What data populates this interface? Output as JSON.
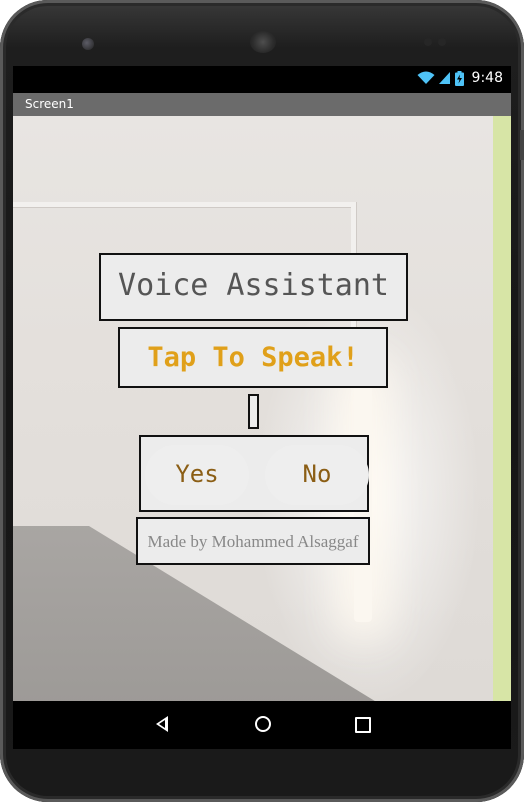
{
  "status_bar": {
    "time": "9:48",
    "wifi_icon": "wifi-icon",
    "signal_icon": "signal-icon",
    "battery_icon": "battery-charging-icon"
  },
  "title_bar": {
    "title": "Screen1"
  },
  "app": {
    "title": "Voice Assistant",
    "speak_button": "Tap To Speak!",
    "result_text": "",
    "yes_button": "Yes",
    "no_button": "No",
    "credit": "Made by Mohammed Alsaggaf"
  },
  "nav_bar": {
    "back_icon": "back-icon",
    "home_icon": "home-icon",
    "recents_icon": "recents-icon"
  },
  "colors": {
    "speak_text": "#e0a01a",
    "yes_no_text": "#8b5e15",
    "title_bar_bg": "#6b6b6b",
    "side_bar": "#d7e5a6"
  }
}
